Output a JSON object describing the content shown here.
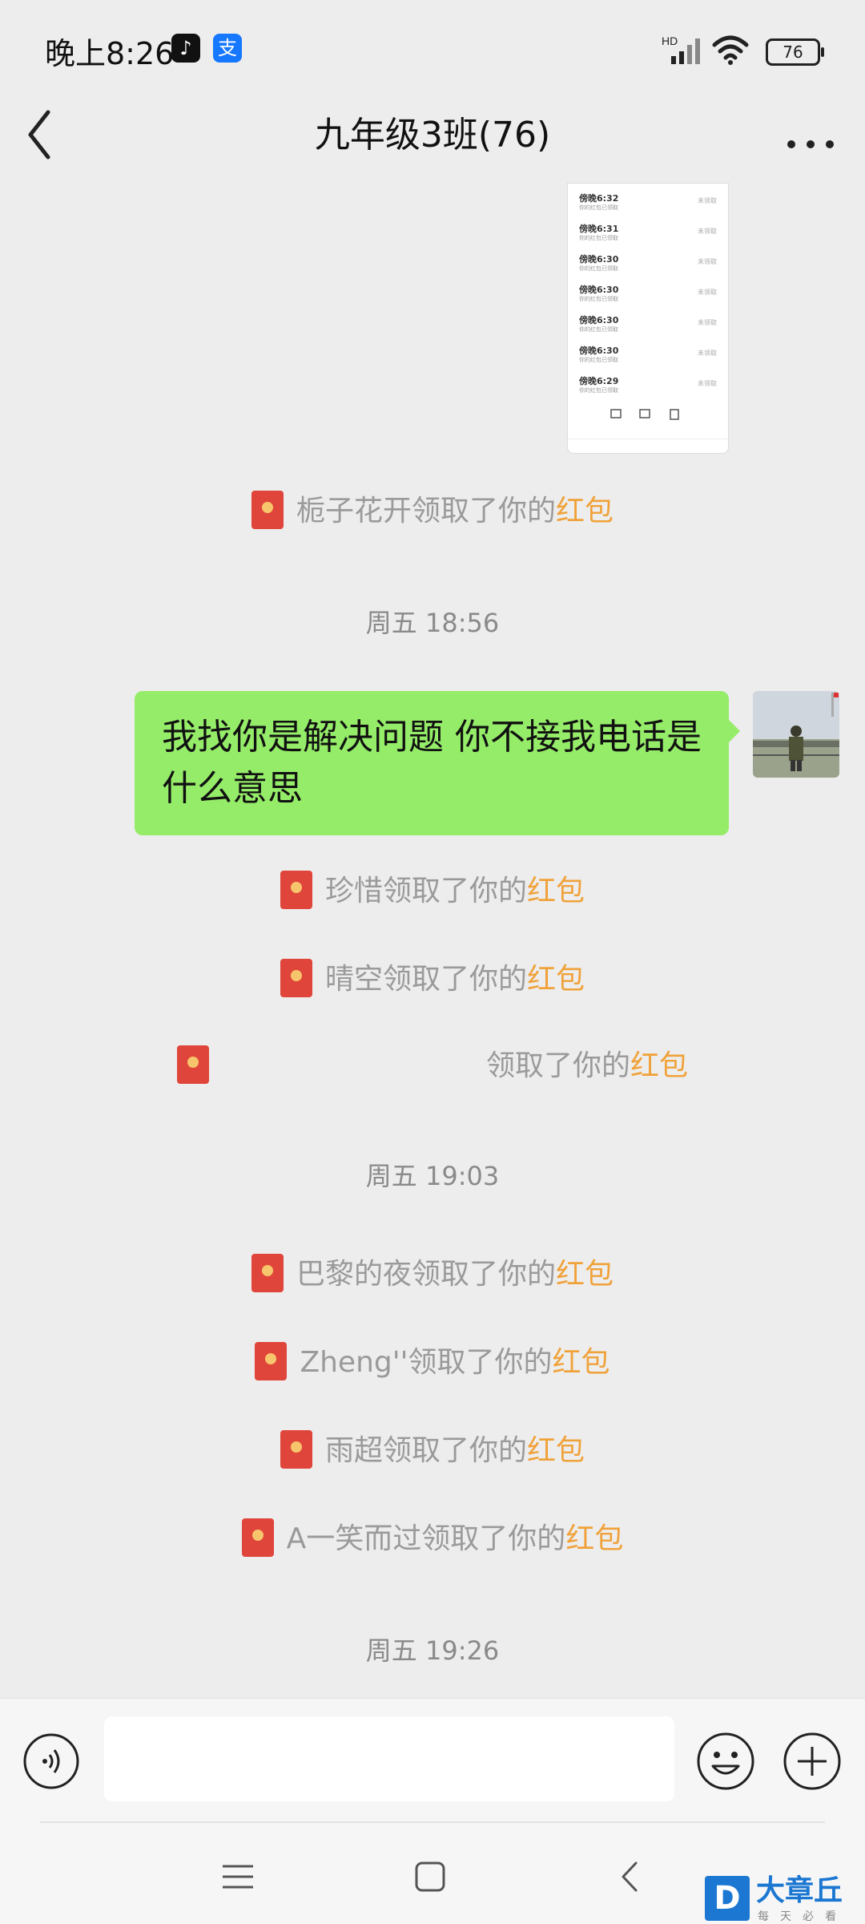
{
  "status_bar": {
    "time": "晚上8:26",
    "tiktok_glyph": "♪",
    "alipay_glyph": "支",
    "battery": "76",
    "network": "HD"
  },
  "header": {
    "title": "九年级3班(76)"
  },
  "thumbnail": {
    "rows": [
      {
        "time": "傍晚6:32",
        "sub": "你的红包已领取",
        "status": "未领取"
      },
      {
        "time": "傍晚6:31",
        "sub": "你的红包已领取",
        "status": "未领取"
      },
      {
        "time": "傍晚6:30",
        "sub": "你的红包已领取",
        "status": "未领取"
      },
      {
        "time": "傍晚6:30",
        "sub": "你的红包已领取",
        "status": "未领取"
      },
      {
        "time": "傍晚6:30",
        "sub": "你的红包已领取",
        "status": "未领取"
      },
      {
        "time": "傍晚6:30",
        "sub": "你的红包已领取",
        "status": "未领取"
      },
      {
        "time": "傍晚6:29",
        "sub": "你的红包已领取",
        "status": "未领取"
      }
    ]
  },
  "messages": {
    "redpacket_word": "红包",
    "claim_suffix": "领取了你的",
    "sys1_name": "栀子花开",
    "ts1": "周五 18:56",
    "bubble_text": "我找你是解决问题  你不接我电话是什么意思",
    "sys2_name": "珍惜",
    "sys3_name": "晴空",
    "sys4_name": "",
    "ts2": "周五 19:03",
    "sys5_name": "巴黎的夜",
    "sys6_name": "Zheng''",
    "sys7_name": "雨超",
    "sys8_name": "A一笑而过",
    "ts3": "周五 19:26"
  },
  "input": {
    "placeholder": ""
  },
  "watermark": {
    "logo": "D",
    "name": "大章丘",
    "sub": "每天必看"
  },
  "colors": {
    "bubble": "#95ec69",
    "redpacket_text": "#f0a23a",
    "redpacket_icon": "#e0453b",
    "background": "#ededed"
  }
}
